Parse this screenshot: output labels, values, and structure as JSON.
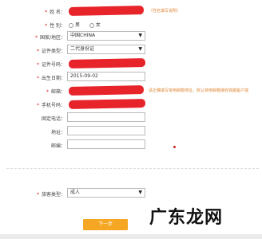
{
  "form": {
    "name": {
      "label": "姓  名：",
      "hint": "（性名填写说明）"
    },
    "gender": {
      "label": "性  别：",
      "option_male": "男",
      "option_female": "女"
    },
    "country": {
      "label": "国家/地区：",
      "value": "中国CHINA"
    },
    "id_type": {
      "label": "证件类型：",
      "value": "二代身份证"
    },
    "id_number": {
      "label": "证件号码："
    },
    "birth_date": {
      "label": "出生日期：",
      "value": "2015-09-02"
    },
    "email": {
      "label": "邮箱：",
      "hint": "请正确填写常用邮箱地址，默认将用邮箱接收铁路客户端"
    },
    "mobile": {
      "label": "手机号码："
    },
    "landline": {
      "label": "固定电话："
    },
    "address": {
      "label": "地址："
    },
    "postcode": {
      "label": "邮编："
    },
    "passenger_type": {
      "label": "旅客类型：",
      "value": "成人"
    },
    "required_mark": "*",
    "select_arrow": "▼",
    "next_label": "下一步"
  },
  "watermark": "广东龙网",
  "colors": {
    "required": "#d91a1a",
    "hint": "#e08a3c",
    "redaction": "#e8242b",
    "button": "#f5a623"
  }
}
